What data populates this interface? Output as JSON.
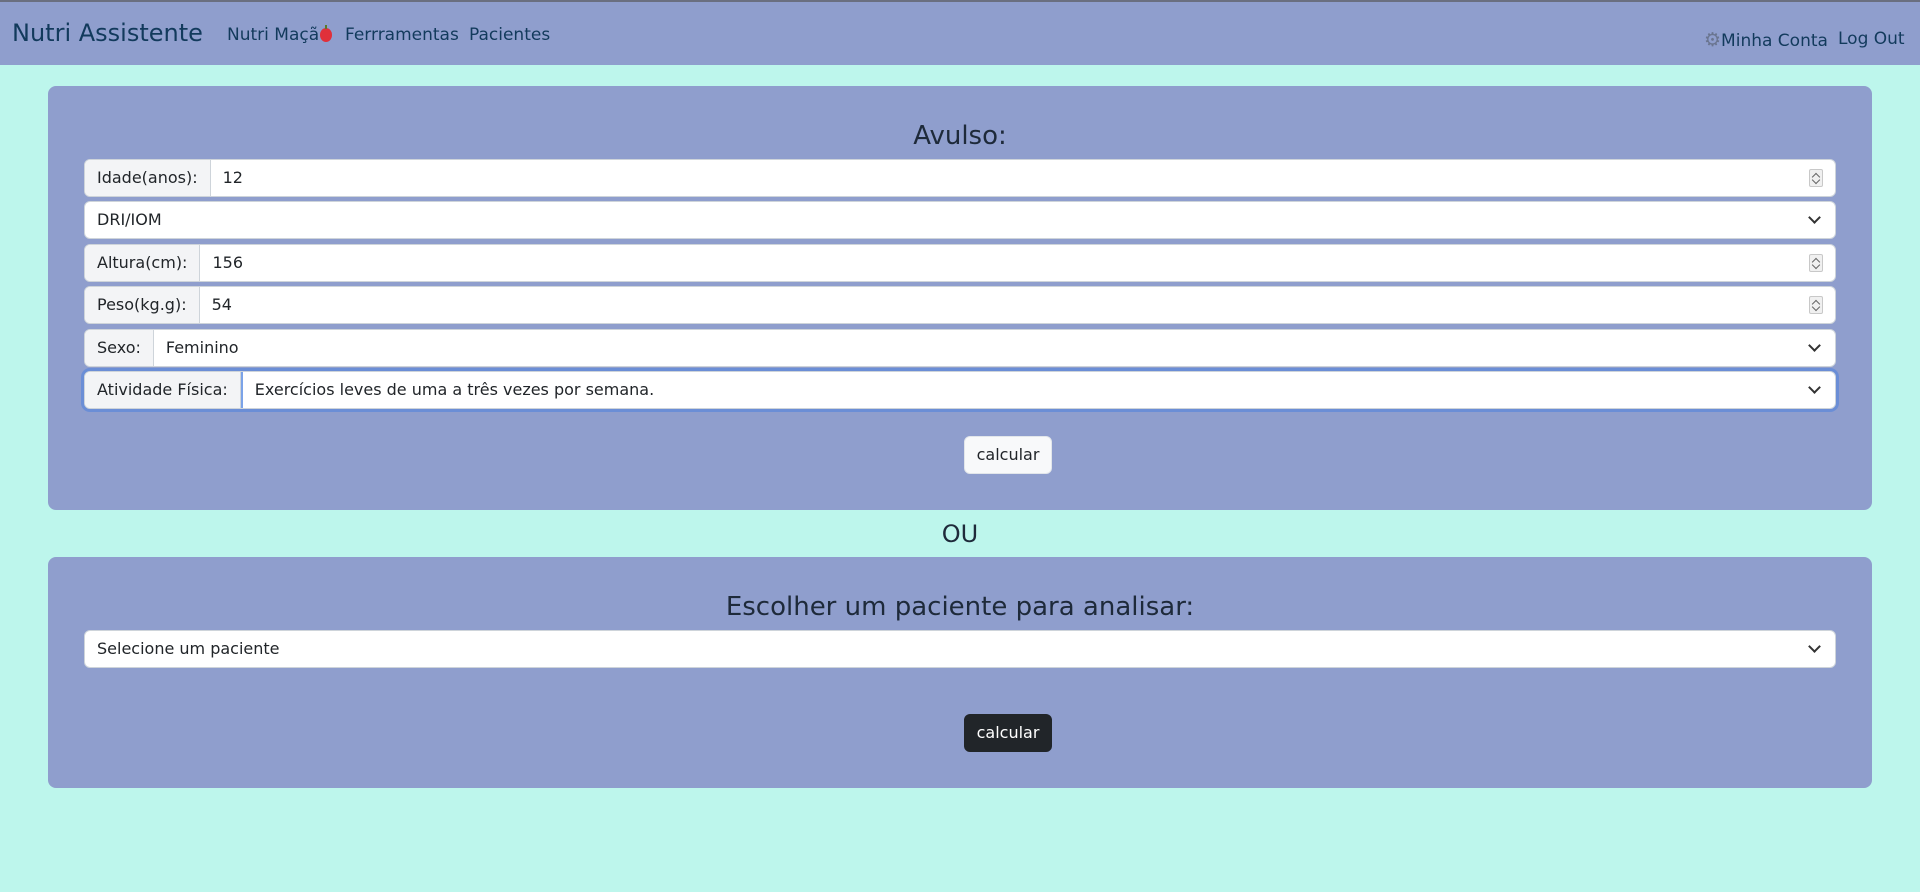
{
  "navbar": {
    "brand": "Nutri Assistente",
    "links": [
      "Nutri Maçã",
      "Ferrramentas",
      "Pacientes"
    ],
    "account": "Minha Conta",
    "logout": "Log Out"
  },
  "avulso": {
    "title": "Avulso:",
    "idade": {
      "label": "Idade(anos):",
      "value": "12"
    },
    "metodo": {
      "value": "DRI/IOM"
    },
    "altura": {
      "label": "Altura(cm):",
      "value": "156"
    },
    "peso": {
      "label": "Peso(kg.g):",
      "value": "54"
    },
    "sexo": {
      "label": "Sexo:",
      "value": "Feminino"
    },
    "atividade": {
      "label": "Atividade Física:",
      "value": "Exercícios leves de uma a três vezes por semana."
    },
    "button": "calcular"
  },
  "separator": "OU",
  "paciente": {
    "title": "Escolher um paciente para analisar:",
    "select": "Selecione um paciente",
    "button": "calcular"
  },
  "colors": {
    "background": "#bdf6ec",
    "panel": "#8f9ecd",
    "brand_text": "#123a5c",
    "apple": "#e0303a",
    "dark_button": "#212529"
  }
}
